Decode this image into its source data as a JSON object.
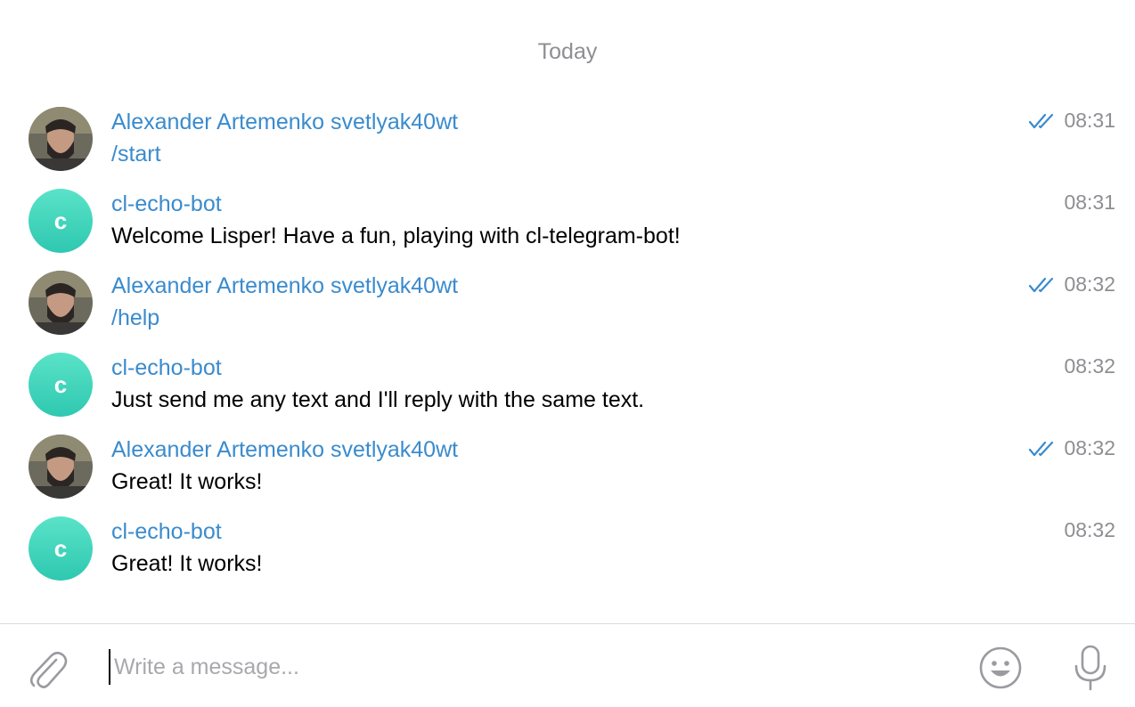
{
  "date_separator": "Today",
  "messages": [
    {
      "sender": "Alexander Artemenko svetlyak40wt",
      "text": "/start",
      "time": "08:31",
      "is_bot": false,
      "read": true,
      "command": true
    },
    {
      "sender": "cl-echo-bot",
      "avatar_letter": "c",
      "text": "Welcome Lisper! Have a fun, playing with cl-telegram-bot!",
      "time": "08:31",
      "is_bot": true,
      "read": false,
      "command": false
    },
    {
      "sender": "Alexander Artemenko svetlyak40wt",
      "text": "/help",
      "time": "08:32",
      "is_bot": false,
      "read": true,
      "command": true
    },
    {
      "sender": "cl-echo-bot",
      "avatar_letter": "c",
      "text": "Just send me any text and I'll reply with the same text.",
      "time": "08:32",
      "is_bot": true,
      "read": false,
      "command": false
    },
    {
      "sender": "Alexander Artemenko svetlyak40wt",
      "text": "Great! It works!",
      "time": "08:32",
      "is_bot": false,
      "read": true,
      "command": false
    },
    {
      "sender": "cl-echo-bot",
      "avatar_letter": "c",
      "text": "Great! It works!",
      "time": "08:32",
      "is_bot": true,
      "read": false,
      "command": false
    }
  ],
  "composer": {
    "placeholder": "Write a message...",
    "value": ""
  },
  "icons": {
    "attach": "paperclip-icon",
    "emoji": "smiley-icon",
    "mic": "microphone-icon",
    "read": "double-check-icon"
  },
  "colors": {
    "accent": "#3a8bcd",
    "bot_avatar": "#3fd3bb",
    "muted": "#8e8e93"
  }
}
